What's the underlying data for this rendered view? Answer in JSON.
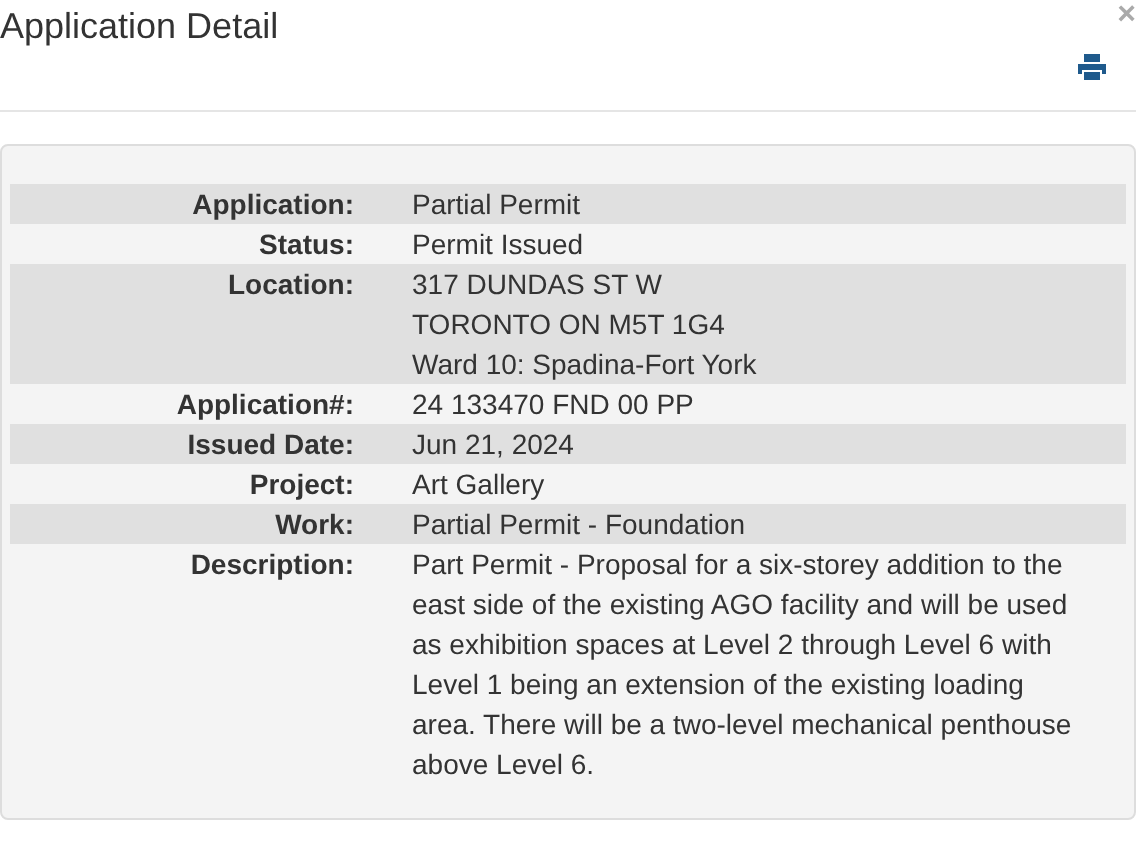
{
  "dialog": {
    "title": "Application Detail",
    "close": "×"
  },
  "details": [
    {
      "label": "Application:",
      "lines": [
        "Partial Permit"
      ]
    },
    {
      "label": "Status:",
      "lines": [
        "Permit Issued"
      ]
    },
    {
      "label": "Location:",
      "lines": [
        "317 DUNDAS ST W",
        "TORONTO ON M5T 1G4",
        "Ward 10: Spadina-Fort York"
      ]
    },
    {
      "label": "Application#:",
      "lines": [
        "24 133470 FND 00 PP"
      ]
    },
    {
      "label": "Issued Date:",
      "lines": [
        "Jun 21, 2024"
      ]
    },
    {
      "label": "Project:",
      "lines": [
        "Art Gallery"
      ]
    },
    {
      "label": "Work:",
      "lines": [
        "Partial Permit - Foundation"
      ]
    },
    {
      "label": "Description:",
      "lines": [
        "Part Permit - Proposal for a six-storey addition to the east side of the existing AGO facility and will be used as exhibition spaces at Level 2 through Level 6 with Level 1 being an extension of the existing loading area. There will be a two-level mechanical penthouse above Level 6."
      ]
    }
  ]
}
